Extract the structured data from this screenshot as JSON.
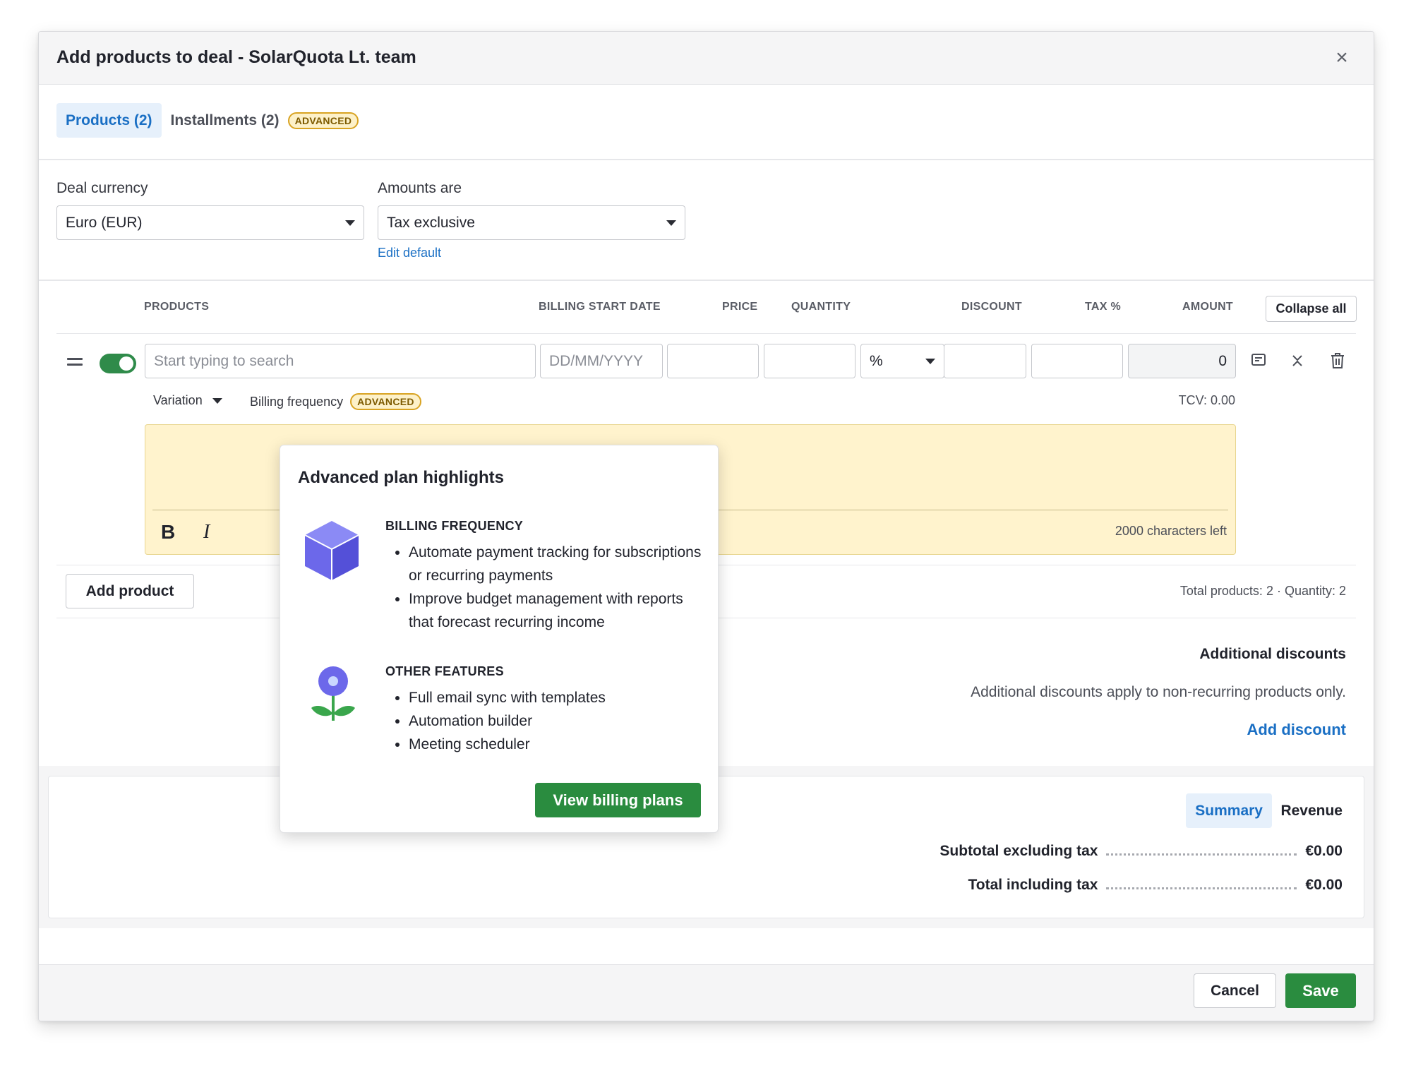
{
  "dialog": {
    "title": "Add products to deal - SolarQuota Lt. team",
    "close_icon": "×"
  },
  "tabs": [
    {
      "label": "Products (2)",
      "active": true
    },
    {
      "label": "Installments (2)",
      "badge": "ADVANCED"
    }
  ],
  "form": {
    "currency_label": "Deal currency",
    "currency_value": "Euro (EUR)",
    "amounts_label": "Amounts are",
    "amounts_value": "Tax exclusive",
    "edit_default": "Edit default"
  },
  "columns": {
    "products": "PRODUCTS",
    "billing_start": "BILLING START DATE",
    "price": "PRICE",
    "quantity": "QUANTITY",
    "discount": "DISCOUNT",
    "tax": "TAX %",
    "amount": "AMOUNT",
    "collapse_all": "Collapse all"
  },
  "row": {
    "search_placeholder": "Start typing to search",
    "date_placeholder": "DD/MM/YYYY",
    "discount_type": "%",
    "amount": "0",
    "variation": "Variation",
    "billing_frequency": "Billing frequency",
    "billing_badge": "ADVANCED",
    "tcv": "TCV: 0.00",
    "bold": "B",
    "italic": "I",
    "chars_left": "2000 characters left"
  },
  "list_footer": {
    "add_product": "Add product",
    "totals": "Total products: 2  ·  Quantity: 2"
  },
  "additional": {
    "title": "Additional discounts",
    "description": "Additional discounts apply to non-recurring products only.",
    "add_discount": "Add discount"
  },
  "summary": {
    "tabs": [
      "Summary",
      "Revenue"
    ],
    "subtotal_label": "Subtotal excluding tax",
    "subtotal_value": "€0.00",
    "total_label": "Total including tax",
    "total_value": "€0.00"
  },
  "footer": {
    "cancel": "Cancel",
    "save": "Save"
  },
  "popup": {
    "title": "Advanced plan highlights",
    "sections": [
      {
        "heading": "BILLING FREQUENCY",
        "icon": "box-icon",
        "items": [
          "Automate payment tracking for subscriptions or recurring payments",
          "Improve budget management with reports that forecast recurring income"
        ]
      },
      {
        "heading": "OTHER FEATURES",
        "icon": "flower-icon",
        "items": [
          "Full email sync with templates",
          "Automation builder",
          "Meeting scheduler"
        ]
      }
    ],
    "cta": "View billing plans"
  },
  "colors": {
    "accent": "#1a6fc4",
    "brand_green": "#2a8c3f",
    "advanced_badge": "#d8a322",
    "note_bg": "#fff3cd"
  }
}
